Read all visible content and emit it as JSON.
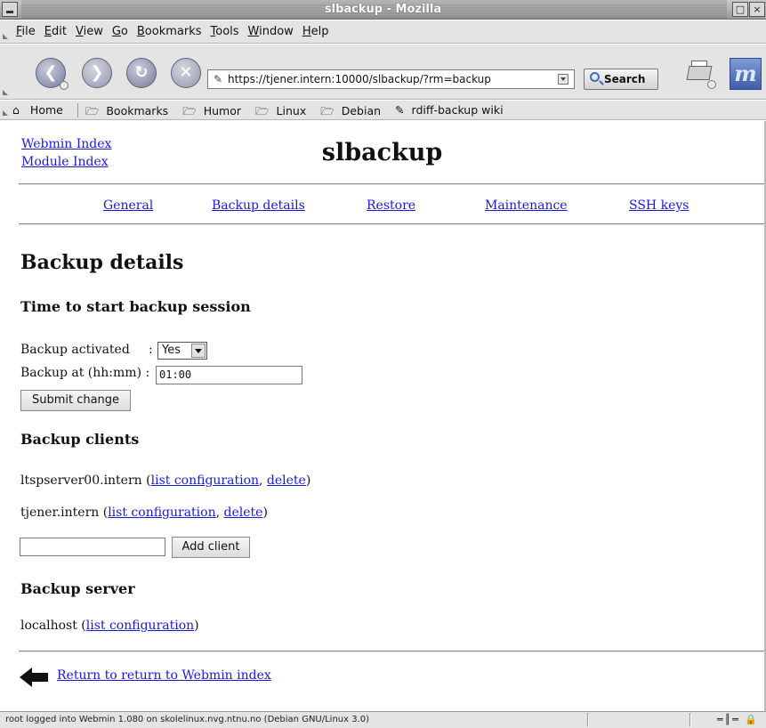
{
  "window": {
    "title": "slbackup - Mozilla"
  },
  "menu": [
    "File",
    "Edit",
    "View",
    "Go",
    "Bookmarks",
    "Tools",
    "Window",
    "Help"
  ],
  "toolbar": {
    "url": "https://tjener.intern:10000/slbackup/?rm=backup",
    "search_label": "Search"
  },
  "personal_toolbar": {
    "home": "Home",
    "bookmarks": "Bookmarks",
    "folders": [
      "Humor",
      "Linux",
      "Debian"
    ],
    "link": "rdiff-backup wiki"
  },
  "page": {
    "webmin_index": "Webmin Index",
    "module_index": "Module Index",
    "title": "slbackup",
    "tabs": [
      "General",
      "Backup details",
      "Restore",
      "Maintenance",
      "SSH keys"
    ],
    "heading": "Backup details",
    "schedule": {
      "heading": "Time to start backup session",
      "activated_label": "Backup activated",
      "activated_colon": ":",
      "activated_value": "Yes",
      "time_label": "Backup at (hh:mm) :",
      "time_value": "01:00",
      "submit": "Submit change"
    },
    "clients": {
      "heading": "Backup clients",
      "items": [
        {
          "host": "ltspserver00.intern",
          "list": "list configuration",
          "delete": "delete"
        },
        {
          "host": "tjener.intern",
          "list": "list configuration",
          "delete": "delete"
        }
      ],
      "add_value": "",
      "add_button": "Add client"
    },
    "server": {
      "heading": "Backup server",
      "host": "localhost",
      "list": "list configuration"
    },
    "return_link": "Return to return to Webmin index"
  },
  "status": {
    "message": "root logged into Webmin 1.080 on skolelinux.nvg.ntnu.no (Debian GNU/Linux 3.0)"
  }
}
